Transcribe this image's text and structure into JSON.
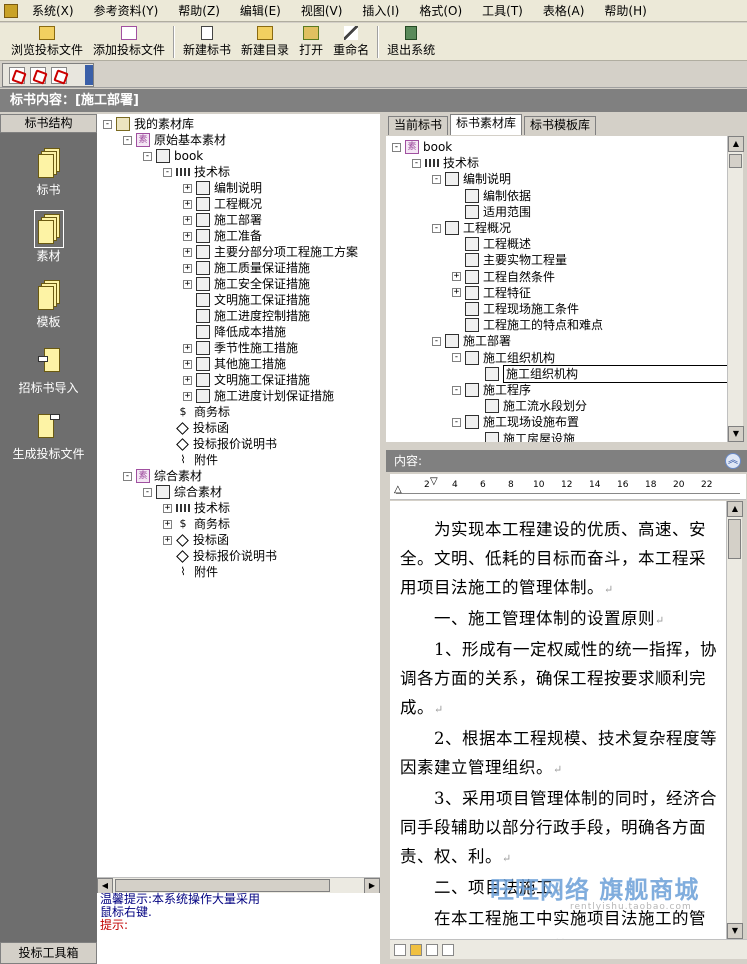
{
  "menu": [
    "系统(X)",
    "参考资料(Y)",
    "帮助(Z)",
    "编辑(E)",
    "视图(V)",
    "插入(I)",
    "格式(O)",
    "工具(T)",
    "表格(A)",
    "帮助(H)"
  ],
  "toolbar": {
    "browse": "浏览投标文件",
    "add": "添加投标文件",
    "new_bid": "新建标书",
    "new_dir": "新建目录",
    "open": "打开",
    "rename": "重命名",
    "exit": "退出系统"
  },
  "title": "标书内容：[施工部署]",
  "left_nav": {
    "header": "标书结构",
    "items": [
      "标书",
      "素材",
      "模板",
      "招标书导入",
      "生成投标文件"
    ],
    "footer": "投标工具箱"
  },
  "tree_left": [
    {
      "label": "我的素材库",
      "exp": "-",
      "icon": "lib"
    },
    {
      "label": "原始基本素材",
      "exp": "-",
      "icon": "su"
    },
    {
      "label": "book",
      "exp": "-",
      "icon": "doc"
    },
    {
      "label": "技术标",
      "exp": "-",
      "icon": "grid"
    },
    {
      "label": "编制说明",
      "exp": "+",
      "icon": "doc"
    },
    {
      "label": "工程概况",
      "exp": "+",
      "icon": "doc"
    },
    {
      "label": "施工部署",
      "exp": "+",
      "icon": "doc"
    },
    {
      "label": "施工准备",
      "exp": "+",
      "icon": "doc"
    },
    {
      "label": "主要分部分项工程施工方案",
      "exp": "+",
      "icon": "doc"
    },
    {
      "label": "施工质量保证措施",
      "exp": "+",
      "icon": "doc"
    },
    {
      "label": "施工安全保证措施",
      "exp": "+",
      "icon": "doc"
    },
    {
      "label": "文明施工保证措施",
      "exp": "",
      "icon": "doc"
    },
    {
      "label": "施工进度控制措施",
      "exp": "",
      "icon": "doc"
    },
    {
      "label": "降低成本措施",
      "exp": "",
      "icon": "doc"
    },
    {
      "label": "季节性施工措施",
      "exp": "+",
      "icon": "doc"
    },
    {
      "label": "其他施工措施",
      "exp": "+",
      "icon": "doc"
    },
    {
      "label": "文明施工保证措施",
      "exp": "+",
      "icon": "doc"
    },
    {
      "label": "施工进度计划保证措施",
      "exp": "+",
      "icon": "doc"
    },
    {
      "label": "商务标",
      "exp": "",
      "icon": "dollar"
    },
    {
      "label": "投标函",
      "exp": "",
      "icon": "diamond"
    },
    {
      "label": "投标报价说明书",
      "exp": "",
      "icon": "diamond"
    },
    {
      "label": "附件",
      "exp": "",
      "icon": "clip"
    },
    {
      "label": "综合素材",
      "exp": "-",
      "icon": "su"
    },
    {
      "label": "综合素材",
      "exp": "-",
      "icon": "doc"
    },
    {
      "label": "技术标",
      "exp": "+",
      "icon": "grid"
    },
    {
      "label": "商务标",
      "exp": "+",
      "icon": "dollar"
    },
    {
      "label": "投标函",
      "exp": "+",
      "icon": "diamond"
    },
    {
      "label": "投标报价说明书",
      "exp": "",
      "icon": "diamond"
    },
    {
      "label": "附件",
      "exp": "",
      "icon": "clip"
    }
  ],
  "status": {
    "line1": "温馨提示:本系统操作大量采用",
    "line2": "鼠标右键.",
    "line3": "提示:"
  },
  "tabs": [
    "当前标书",
    "标书素材库",
    "标书模板库"
  ],
  "tree_right": [
    {
      "label": "book",
      "exp": "-",
      "icon": "su"
    },
    {
      "label": "技术标",
      "exp": "-",
      "icon": "grid"
    },
    {
      "label": "编制说明",
      "exp": "-",
      "icon": "doc"
    },
    {
      "label": "编制依据",
      "exp": "",
      "icon": "doc"
    },
    {
      "label": "适用范围",
      "exp": "",
      "icon": "doc"
    },
    {
      "label": "工程概况",
      "exp": "-",
      "icon": "doc"
    },
    {
      "label": "工程概述",
      "exp": "",
      "icon": "doc"
    },
    {
      "label": "主要实物工程量",
      "exp": "",
      "icon": "doc"
    },
    {
      "label": "工程自然条件",
      "exp": "+",
      "icon": "doc"
    },
    {
      "label": "工程特征",
      "exp": "+",
      "icon": "doc"
    },
    {
      "label": "工程现场施工条件",
      "exp": "",
      "icon": "doc"
    },
    {
      "label": "工程施工的特点和难点",
      "exp": "",
      "icon": "doc"
    },
    {
      "label": "施工部署",
      "exp": "-",
      "icon": "doc"
    },
    {
      "label": "施工组织机构",
      "exp": "-",
      "icon": "doc"
    },
    {
      "label": "施工组织机构",
      "exp": "",
      "icon": "doc"
    },
    {
      "label": "施工程序",
      "exp": "-",
      "icon": "doc"
    },
    {
      "label": "施工流水段划分",
      "exp": "",
      "icon": "doc"
    },
    {
      "label": "施工现场设施布置",
      "exp": "-",
      "icon": "doc"
    },
    {
      "label": "施工房屋设施",
      "exp": "",
      "icon": "doc"
    }
  ],
  "content_label": "内容:",
  "ruler_ticks": [
    "2",
    "4",
    "6",
    "8",
    "10",
    "12",
    "14",
    "16",
    "18",
    "20",
    "22"
  ],
  "doc_paragraphs": [
    "为实现本工程建设的优质、高速、安全。文明、低耗的目标而奋斗，本工程采用项目法施工的管理体制。",
    "一、施工管理体制的设置原则",
    "1、形成有一定权威性的统一指挥，协调各方面的关系，确保工程按要求顺利完成。",
    "2、根据本工程规模、技术复杂程度等因素建立管理组织。",
    "3、采用项目管理体制的同时，经济合同手段辅助以部分行政手段，明确各方面责、权、利。",
    "二、项目法施工",
    "在本工程施工中实施项目法施工的管理模式，组建本工程的项目经理"
  ],
  "watermark": {
    "main": "旺旺网络 旗舰商城",
    "sub": "rentlyishu.taobao.com"
  }
}
